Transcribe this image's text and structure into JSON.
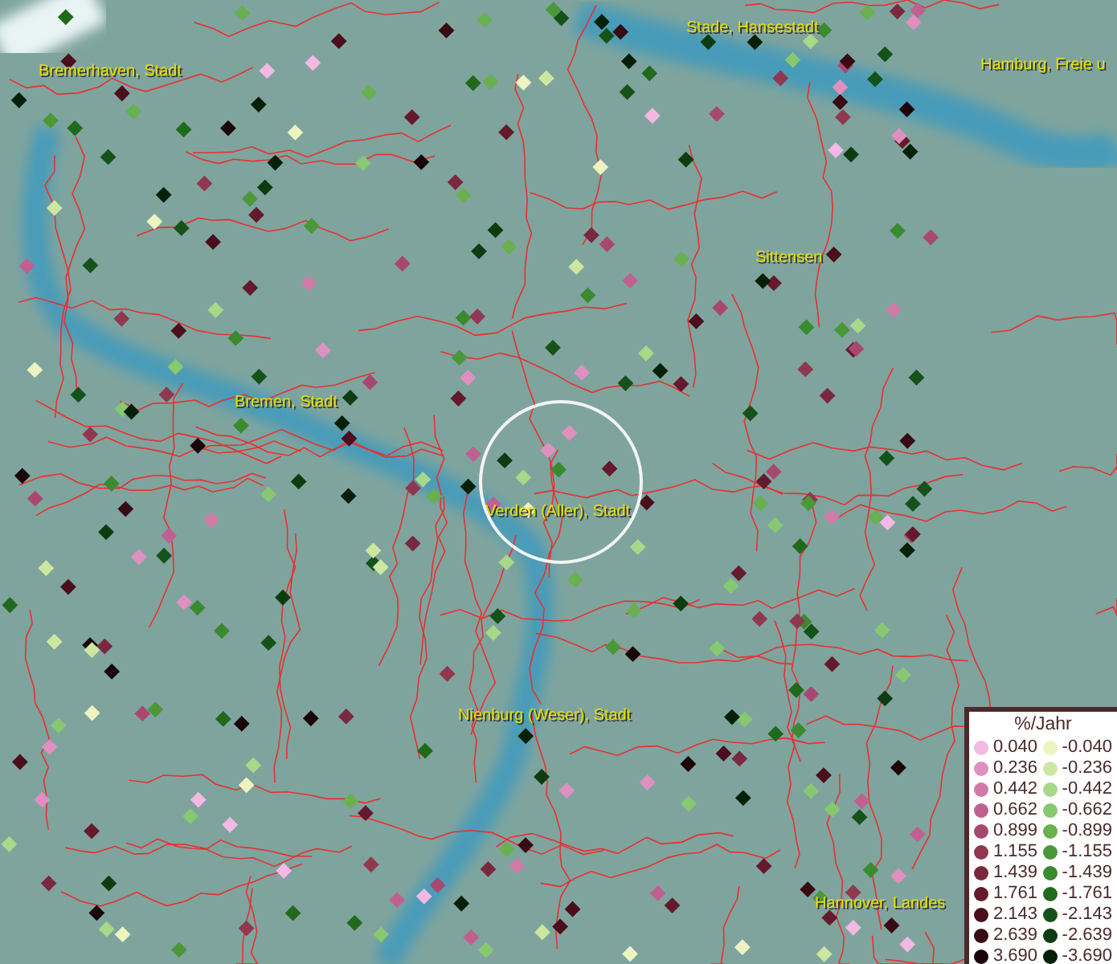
{
  "map": {
    "labels": [
      {
        "text": "Bremerhaven, Stadt"
      },
      {
        "text": "Stade, Hansestadt"
      },
      {
        "text": "Hamburg, Freie u"
      },
      {
        "text": "Sittensen"
      },
      {
        "text": "Bremen, Stadt"
      },
      {
        "text": "Verden (Aller), Stadt"
      },
      {
        "text": "Nienburg (Weser), Stadt"
      },
      {
        "text": "Hannover, Landes"
      }
    ]
  },
  "legend": {
    "title": "%/Jahr",
    "rows": [
      {
        "positive": {
          "value": "0.040",
          "color": "#f4b8e4"
        },
        "negative": {
          "value": "-0.040",
          "color": "#eef4c0"
        }
      },
      {
        "positive": {
          "value": "0.236",
          "color": "#e090c0"
        },
        "negative": {
          "value": "-0.236",
          "color": "#cce8a0"
        }
      },
      {
        "positive": {
          "value": "0.442",
          "color": "#d07aa8"
        },
        "negative": {
          "value": "-0.442",
          "color": "#a8d888"
        }
      },
      {
        "positive": {
          "value": "0.662",
          "color": "#c06090"
        },
        "negative": {
          "value": "-0.662",
          "color": "#88c870"
        }
      },
      {
        "positive": {
          "value": "0.899",
          "color": "#a84870"
        },
        "negative": {
          "value": "-0.899",
          "color": "#68b050"
        }
      },
      {
        "positive": {
          "value": "1.155",
          "color": "#903850"
        },
        "negative": {
          "value": "-1.155",
          "color": "#4a9838"
        }
      },
      {
        "positive": {
          "value": "1.439",
          "color": "#7a2840"
        },
        "negative": {
          "value": "-1.439",
          "color": "#3a8a30"
        }
      },
      {
        "positive": {
          "value": "1.761",
          "color": "#641a2c"
        },
        "negative": {
          "value": "-1.761",
          "color": "#206a1c"
        }
      },
      {
        "positive": {
          "value": "2.143",
          "color": "#4a0e1c"
        },
        "negative": {
          "value": "-2.143",
          "color": "#14521a"
        }
      },
      {
        "positive": {
          "value": "2.639",
          "color": "#380a14"
        },
        "negative": {
          "value": "-2.639",
          "color": "#0c3c10"
        }
      },
      {
        "positive": {
          "value": "3.690",
          "color": "#1a0408"
        },
        "negative": {
          "value": "-3.690",
          "color": "#042008"
        }
      }
    ]
  }
}
